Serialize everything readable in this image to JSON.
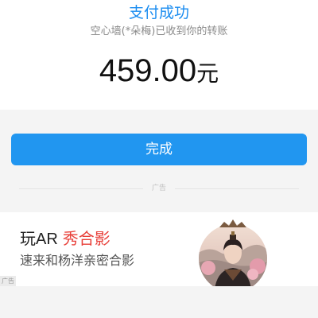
{
  "payment": {
    "status_title": "支付成功",
    "status_subtitle": "空心墙(*朵梅)已收到你的转账",
    "amount": "459.00",
    "currency_unit": "元"
  },
  "actions": {
    "done_label": "完成"
  },
  "ad": {
    "divider_label": "广告",
    "title_plain": "玩AR",
    "title_accent": "秀合影",
    "subtitle": "速来和杨洋亲密合影",
    "corner_label": "广告",
    "accent_color": "#e8403a"
  },
  "colors": {
    "brand_blue": "#2196f0",
    "status_blue": "#1a8cf0"
  }
}
